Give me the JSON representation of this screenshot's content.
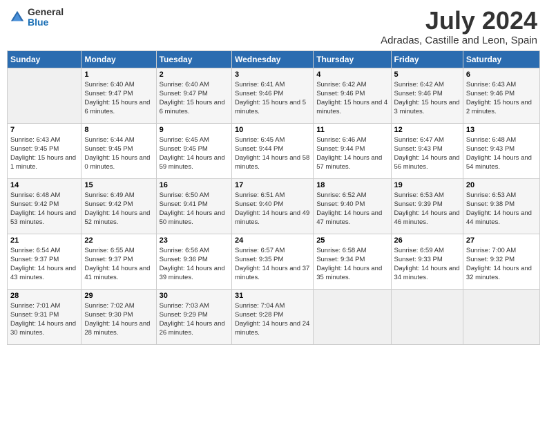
{
  "logo": {
    "general": "General",
    "blue": "Blue"
  },
  "header": {
    "month_year": "July 2024",
    "location": "Adradas, Castille and Leon, Spain"
  },
  "days_of_week": [
    "Sunday",
    "Monday",
    "Tuesday",
    "Wednesday",
    "Thursday",
    "Friday",
    "Saturday"
  ],
  "weeks": [
    [
      {
        "day": "",
        "sunrise": "",
        "sunset": "",
        "daylight": "",
        "empty": true
      },
      {
        "day": "1",
        "sunrise": "Sunrise: 6:40 AM",
        "sunset": "Sunset: 9:47 PM",
        "daylight": "Daylight: 15 hours and 6 minutes."
      },
      {
        "day": "2",
        "sunrise": "Sunrise: 6:40 AM",
        "sunset": "Sunset: 9:47 PM",
        "daylight": "Daylight: 15 hours and 6 minutes."
      },
      {
        "day": "3",
        "sunrise": "Sunrise: 6:41 AM",
        "sunset": "Sunset: 9:46 PM",
        "daylight": "Daylight: 15 hours and 5 minutes."
      },
      {
        "day": "4",
        "sunrise": "Sunrise: 6:42 AM",
        "sunset": "Sunset: 9:46 PM",
        "daylight": "Daylight: 15 hours and 4 minutes."
      },
      {
        "day": "5",
        "sunrise": "Sunrise: 6:42 AM",
        "sunset": "Sunset: 9:46 PM",
        "daylight": "Daylight: 15 hours and 3 minutes."
      },
      {
        "day": "6",
        "sunrise": "Sunrise: 6:43 AM",
        "sunset": "Sunset: 9:46 PM",
        "daylight": "Daylight: 15 hours and 2 minutes."
      }
    ],
    [
      {
        "day": "7",
        "sunrise": "Sunrise: 6:43 AM",
        "sunset": "Sunset: 9:45 PM",
        "daylight": "Daylight: 15 hours and 1 minute."
      },
      {
        "day": "8",
        "sunrise": "Sunrise: 6:44 AM",
        "sunset": "Sunset: 9:45 PM",
        "daylight": "Daylight: 15 hours and 0 minutes."
      },
      {
        "day": "9",
        "sunrise": "Sunrise: 6:45 AM",
        "sunset": "Sunset: 9:45 PM",
        "daylight": "Daylight: 14 hours and 59 minutes."
      },
      {
        "day": "10",
        "sunrise": "Sunrise: 6:45 AM",
        "sunset": "Sunset: 9:44 PM",
        "daylight": "Daylight: 14 hours and 58 minutes."
      },
      {
        "day": "11",
        "sunrise": "Sunrise: 6:46 AM",
        "sunset": "Sunset: 9:44 PM",
        "daylight": "Daylight: 14 hours and 57 minutes."
      },
      {
        "day": "12",
        "sunrise": "Sunrise: 6:47 AM",
        "sunset": "Sunset: 9:43 PM",
        "daylight": "Daylight: 14 hours and 56 minutes."
      },
      {
        "day": "13",
        "sunrise": "Sunrise: 6:48 AM",
        "sunset": "Sunset: 9:43 PM",
        "daylight": "Daylight: 14 hours and 54 minutes."
      }
    ],
    [
      {
        "day": "14",
        "sunrise": "Sunrise: 6:48 AM",
        "sunset": "Sunset: 9:42 PM",
        "daylight": "Daylight: 14 hours and 53 minutes."
      },
      {
        "day": "15",
        "sunrise": "Sunrise: 6:49 AM",
        "sunset": "Sunset: 9:42 PM",
        "daylight": "Daylight: 14 hours and 52 minutes."
      },
      {
        "day": "16",
        "sunrise": "Sunrise: 6:50 AM",
        "sunset": "Sunset: 9:41 PM",
        "daylight": "Daylight: 14 hours and 50 minutes."
      },
      {
        "day": "17",
        "sunrise": "Sunrise: 6:51 AM",
        "sunset": "Sunset: 9:40 PM",
        "daylight": "Daylight: 14 hours and 49 minutes."
      },
      {
        "day": "18",
        "sunrise": "Sunrise: 6:52 AM",
        "sunset": "Sunset: 9:40 PM",
        "daylight": "Daylight: 14 hours and 47 minutes."
      },
      {
        "day": "19",
        "sunrise": "Sunrise: 6:53 AM",
        "sunset": "Sunset: 9:39 PM",
        "daylight": "Daylight: 14 hours and 46 minutes."
      },
      {
        "day": "20",
        "sunrise": "Sunrise: 6:53 AM",
        "sunset": "Sunset: 9:38 PM",
        "daylight": "Daylight: 14 hours and 44 minutes."
      }
    ],
    [
      {
        "day": "21",
        "sunrise": "Sunrise: 6:54 AM",
        "sunset": "Sunset: 9:37 PM",
        "daylight": "Daylight: 14 hours and 43 minutes."
      },
      {
        "day": "22",
        "sunrise": "Sunrise: 6:55 AM",
        "sunset": "Sunset: 9:37 PM",
        "daylight": "Daylight: 14 hours and 41 minutes."
      },
      {
        "day": "23",
        "sunrise": "Sunrise: 6:56 AM",
        "sunset": "Sunset: 9:36 PM",
        "daylight": "Daylight: 14 hours and 39 minutes."
      },
      {
        "day": "24",
        "sunrise": "Sunrise: 6:57 AM",
        "sunset": "Sunset: 9:35 PM",
        "daylight": "Daylight: 14 hours and 37 minutes."
      },
      {
        "day": "25",
        "sunrise": "Sunrise: 6:58 AM",
        "sunset": "Sunset: 9:34 PM",
        "daylight": "Daylight: 14 hours and 35 minutes."
      },
      {
        "day": "26",
        "sunrise": "Sunrise: 6:59 AM",
        "sunset": "Sunset: 9:33 PM",
        "daylight": "Daylight: 14 hours and 34 minutes."
      },
      {
        "day": "27",
        "sunrise": "Sunrise: 7:00 AM",
        "sunset": "Sunset: 9:32 PM",
        "daylight": "Daylight: 14 hours and 32 minutes."
      }
    ],
    [
      {
        "day": "28",
        "sunrise": "Sunrise: 7:01 AM",
        "sunset": "Sunset: 9:31 PM",
        "daylight": "Daylight: 14 hours and 30 minutes."
      },
      {
        "day": "29",
        "sunrise": "Sunrise: 7:02 AM",
        "sunset": "Sunset: 9:30 PM",
        "daylight": "Daylight: 14 hours and 28 minutes."
      },
      {
        "day": "30",
        "sunrise": "Sunrise: 7:03 AM",
        "sunset": "Sunset: 9:29 PM",
        "daylight": "Daylight: 14 hours and 26 minutes."
      },
      {
        "day": "31",
        "sunrise": "Sunrise: 7:04 AM",
        "sunset": "Sunset: 9:28 PM",
        "daylight": "Daylight: 14 hours and 24 minutes."
      },
      {
        "day": "",
        "sunrise": "",
        "sunset": "",
        "daylight": "",
        "empty": true
      },
      {
        "day": "",
        "sunrise": "",
        "sunset": "",
        "daylight": "",
        "empty": true
      },
      {
        "day": "",
        "sunrise": "",
        "sunset": "",
        "daylight": "",
        "empty": true
      }
    ]
  ]
}
